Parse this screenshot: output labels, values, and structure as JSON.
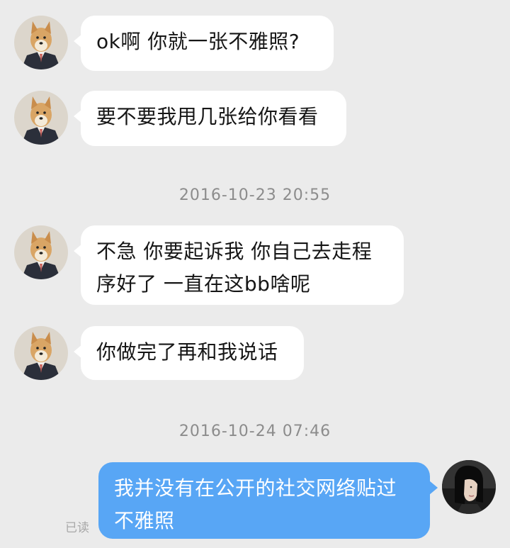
{
  "messages": [
    {
      "id": 1,
      "direction": "incoming",
      "lines": [
        "ok啊 你就一张不雅照?"
      ],
      "avatar_icon": "shiba-dog-avatar-icon"
    },
    {
      "id": 2,
      "direction": "incoming",
      "lines": [
        "要不要我甩几张给你看看"
      ],
      "avatar_icon": "shiba-dog-avatar-icon"
    },
    {
      "id": 3,
      "direction": "incoming",
      "lines": [
        "不急 你要起诉我 你自己去走程",
        "序好了 一直在这bb啥呢"
      ],
      "avatar_icon": "shiba-dog-avatar-icon"
    },
    {
      "id": 4,
      "direction": "incoming",
      "lines": [
        "你做完了再和我说话"
      ],
      "avatar_icon": "shiba-dog-avatar-icon"
    },
    {
      "id": 5,
      "direction": "outgoing",
      "lines": [
        "我并没有在公开的社交网络贴过",
        "不雅照"
      ],
      "avatar_icon": "woman-portrait-avatar-icon",
      "status": "已读"
    }
  ],
  "timestamps": [
    "2016-10-23 20:55",
    "2016-10-24 07:46"
  ],
  "colors": {
    "background": "#ebebeb",
    "incoming_bubble": "#ffffff",
    "outgoing_bubble": "#58a6f5",
    "timestamp_text": "#8c8c8c"
  }
}
